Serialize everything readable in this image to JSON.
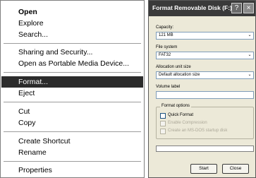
{
  "context_menu": {
    "items": [
      {
        "label": "Open",
        "bold": true
      },
      {
        "label": "Explore"
      },
      {
        "label": "Search..."
      },
      {
        "label": "Sharing and Security..."
      },
      {
        "label": "Open as Portable Media Device..."
      },
      {
        "label": "Format...",
        "selected": true
      },
      {
        "label": "Eject"
      },
      {
        "label": "Cut"
      },
      {
        "label": "Copy"
      },
      {
        "label": "Create Shortcut"
      },
      {
        "label": "Rename"
      },
      {
        "label": "Properties"
      }
    ]
  },
  "dialog": {
    "title": "Format Removable Disk (F:)",
    "help_glyph": "?",
    "close_glyph": "×",
    "capacity": {
      "label": "Capacity:",
      "value": "121 MB"
    },
    "file_system": {
      "label": "File system",
      "value": "FAT32"
    },
    "allocation": {
      "label": "Allocation unit size",
      "value": "Default allocation size"
    },
    "volume_label": {
      "label": "Volume label",
      "value": ""
    },
    "format_options": {
      "title": "Format options",
      "quick_format": {
        "label": "Quick Format",
        "checked": false,
        "enabled": true
      },
      "compression": {
        "label": "Enable Compression",
        "checked": false,
        "enabled": false
      },
      "startup_disk": {
        "label": "Create an MS-DOS startup disk",
        "checked": false,
        "enabled": false
      }
    },
    "progress": 0,
    "start_label": "Start",
    "close_label": "Close",
    "dropdown_arrow": "⌄"
  },
  "colors": {
    "selected_bg": "#2b2b2b",
    "titlebar": "#3a3a3a",
    "dialog_face": "#ece9d8"
  }
}
